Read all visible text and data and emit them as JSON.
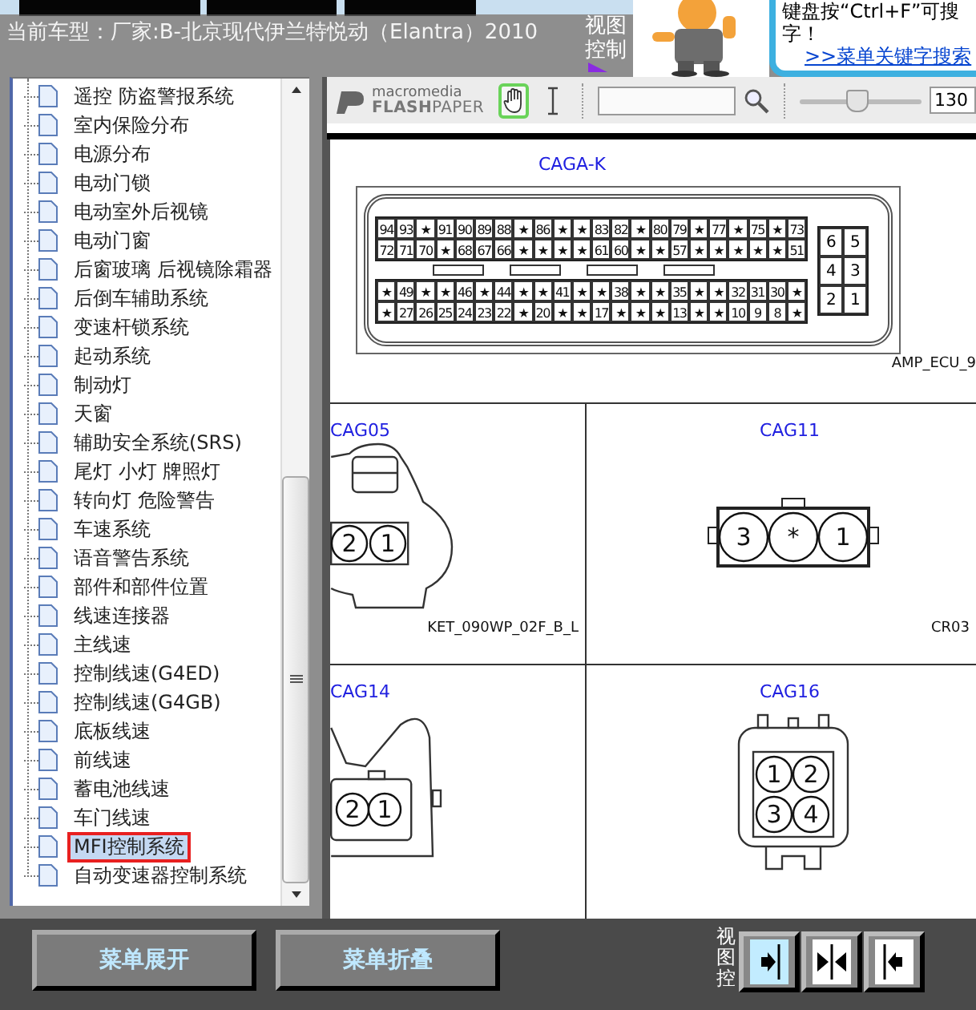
{
  "header": {
    "vehicle_label": "当前车型：厂家:B-北京现代伊兰特悦动（Elantra）2010",
    "view_control": "视图控制",
    "tip_lines": [
      "键盘按“Ctrl+F”可搜",
      "字！"
    ],
    "search_link": ">>菜单关键字搜索"
  },
  "tree": {
    "items": [
      {
        "label": "遥控 防盗警报系统",
        "selected": false
      },
      {
        "label": "室内保险分布",
        "selected": false
      },
      {
        "label": "电源分布",
        "selected": false
      },
      {
        "label": "电动门锁",
        "selected": false
      },
      {
        "label": "电动室外后视镜",
        "selected": false
      },
      {
        "label": "电动门窗",
        "selected": false
      },
      {
        "label": "后窗玻璃 后视镜除霜器",
        "selected": false
      },
      {
        "label": "后倒车辅助系统",
        "selected": false
      },
      {
        "label": "变速杆锁系统",
        "selected": false
      },
      {
        "label": "起动系统",
        "selected": false
      },
      {
        "label": "制动灯",
        "selected": false
      },
      {
        "label": "天窗",
        "selected": false
      },
      {
        "label": "辅助安全系统(SRS)",
        "selected": false
      },
      {
        "label": "尾灯 小灯 牌照灯",
        "selected": false
      },
      {
        "label": "转向灯 危险警告",
        "selected": false
      },
      {
        "label": "车速系统",
        "selected": false
      },
      {
        "label": "语音警告系统",
        "selected": false
      },
      {
        "label": "部件和部件位置",
        "selected": false
      },
      {
        "label": "线速连接器",
        "selected": false
      },
      {
        "label": "主线速",
        "selected": false
      },
      {
        "label": "控制线速(G4ED)",
        "selected": false
      },
      {
        "label": "控制线速(G4GB)",
        "selected": false
      },
      {
        "label": "底板线速",
        "selected": false
      },
      {
        "label": "前线速",
        "selected": false
      },
      {
        "label": "蓄电池线速",
        "selected": false
      },
      {
        "label": "车门线速",
        "selected": false
      },
      {
        "label": "MFI控制系统",
        "selected": true
      },
      {
        "label": "自动变速器控制系统",
        "selected": false
      }
    ]
  },
  "viewer": {
    "toolbar": {
      "logo_top": "macromedia",
      "logo_bottom": "**FLASH**PAPER",
      "tools": [
        {
          "kind": "hand",
          "selected": true
        },
        {
          "kind": "text",
          "selected": false
        }
      ],
      "zoom": {
        "level": 0.46,
        "value": "130"
      }
    },
    "main_connector": {
      "title": "CAGA-K",
      "rows": [
        [
          "94",
          "93",
          "★",
          "91",
          "90",
          "89",
          "88",
          "★",
          "86",
          "★",
          "★",
          "83",
          "82",
          "★",
          "80",
          "79",
          "★",
          "77",
          "★",
          "75",
          "★",
          "73"
        ],
        [
          "72",
          "71",
          "70",
          "★",
          "68",
          "67",
          "66",
          "★",
          "★",
          "★",
          "★",
          "61",
          "60",
          "★",
          "★",
          "57",
          "★",
          "★",
          "★",
          "★",
          "★",
          "51"
        ],
        [
          "★",
          "49",
          "★",
          "★",
          "46",
          "★",
          "44",
          "★",
          "★",
          "41",
          "★",
          "★",
          "38",
          "★",
          "★",
          "35",
          "★",
          "★",
          "32",
          "31",
          "30",
          "★"
        ],
        [
          "★",
          "27",
          "26",
          "25",
          "24",
          "23",
          "22",
          "★",
          "20",
          "★",
          "★",
          "17",
          "★",
          "★",
          "★",
          "13",
          "★",
          "★",
          "10",
          "9",
          "8",
          "★"
        ]
      ],
      "side_rows": [
        [
          "6",
          "5"
        ],
        [
          "4",
          "3"
        ],
        [
          "2",
          "1"
        ]
      ],
      "code": "AMP_ECU_9"
    },
    "connectors": [
      {
        "kind": "cag05",
        "title": "CAG05",
        "pins": [
          "2",
          "1"
        ],
        "code": "KET_090WP_02F_B_L"
      },
      {
        "kind": "cag11",
        "title": "CAG11",
        "pins": [
          "3",
          "*",
          "1"
        ],
        "code": "CR03"
      },
      {
        "kind": "cag14",
        "title": "CAG14",
        "pins": [
          "2",
          "1"
        ]
      },
      {
        "kind": "cag16",
        "title": "CAG16",
        "pins": [
          "1",
          "2",
          "3",
          "4"
        ]
      }
    ]
  },
  "footer": {
    "buttons": [
      "菜单展开",
      "菜单折叠"
    ],
    "view_control": "视图控",
    "view_buttons": [
      {
        "kind": "right",
        "selected": true
      },
      {
        "kind": "both",
        "selected": false
      },
      {
        "kind": "left",
        "selected": false
      }
    ]
  }
}
